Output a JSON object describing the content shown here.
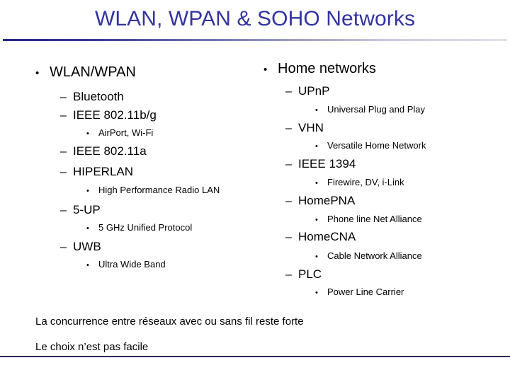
{
  "slide": {
    "title": "WLAN, WPAN & SOHO Networks",
    "accent_color": "#3333a0",
    "rule_color_dark": "#272787",
    "rule_color_light": "#e2e2ea",
    "bottom_rule_color": "#2e2a52",
    "background_color": "#ffffff",
    "text_color": "#000000"
  },
  "markers": {
    "level1": "•",
    "level2": "–",
    "level3": "•"
  },
  "left_column": {
    "heading": "WLAN/WPAN",
    "items": [
      {
        "level": 2,
        "label": "Bluetooth"
      },
      {
        "level": 2,
        "label": "IEEE 802.11b/g"
      },
      {
        "level": 3,
        "label": "AirPort, Wi-Fi"
      },
      {
        "level": 2,
        "label": "IEEE 802.11a"
      },
      {
        "level": 2,
        "label": "HIPERLAN"
      },
      {
        "level": 3,
        "label": "High Performance Radio LAN"
      },
      {
        "level": 2,
        "label": "5-UP"
      },
      {
        "level": 3,
        "label": "5 GHz Unified Protocol"
      },
      {
        "level": 2,
        "label": "UWB"
      },
      {
        "level": 3,
        "label": "Ultra Wide Band"
      }
    ]
  },
  "right_column": {
    "heading": "Home networks",
    "items": [
      {
        "level": 2,
        "label": "UPnP"
      },
      {
        "level": 3,
        "label": "Universal Plug and Play"
      },
      {
        "level": 2,
        "label": "VHN"
      },
      {
        "level": 3,
        "label": "Versatile Home Network"
      },
      {
        "level": 2,
        "label": "IEEE 1394"
      },
      {
        "level": 3,
        "label": "Firewire, DV, i-Link"
      },
      {
        "level": 2,
        "label": "HomePNA"
      },
      {
        "level": 3,
        "label": "Phone line Net Alliance"
      },
      {
        "level": 2,
        "label": "HomeCNA"
      },
      {
        "level": 3,
        "label": "Cable Network Alliance"
      },
      {
        "level": 2,
        "label": "PLC"
      },
      {
        "level": 3,
        "label": "Power Line Carrier"
      }
    ]
  },
  "footer": {
    "line1": "La concurrence entre réseaux avec ou sans fil reste forte",
    "line2": "Le choix n’est pas facile"
  }
}
